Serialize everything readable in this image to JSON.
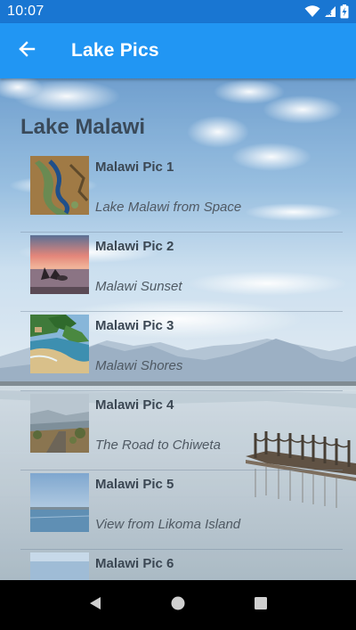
{
  "status_bar": {
    "time": "10:07",
    "icons": [
      "wifi-icon",
      "signal-icon",
      "battery-icon"
    ]
  },
  "app_bar": {
    "title": "Lake Pics",
    "back_icon": "arrow-back-icon"
  },
  "section": {
    "heading": "Lake Malawi"
  },
  "items": [
    {
      "title": "Malawi Pic 1",
      "subtitle": "Lake Malawi from Space"
    },
    {
      "title": "Malawi Pic 2",
      "subtitle": "Malawi Sunset"
    },
    {
      "title": "Malawi Pic 3",
      "subtitle": "Malawi Shores"
    },
    {
      "title": "Malawi Pic 4",
      "subtitle": "The Road to Chiweta"
    },
    {
      "title": "Malawi Pic 5",
      "subtitle": "View from Likoma Island"
    },
    {
      "title": "Malawi Pic 6",
      "subtitle": ""
    }
  ],
  "nav_bar": {
    "buttons": [
      "back-triangle-icon",
      "home-circle-icon",
      "recents-square-icon"
    ]
  },
  "colors": {
    "status_bar": "#1976D2",
    "app_bar": "#2196F3"
  }
}
